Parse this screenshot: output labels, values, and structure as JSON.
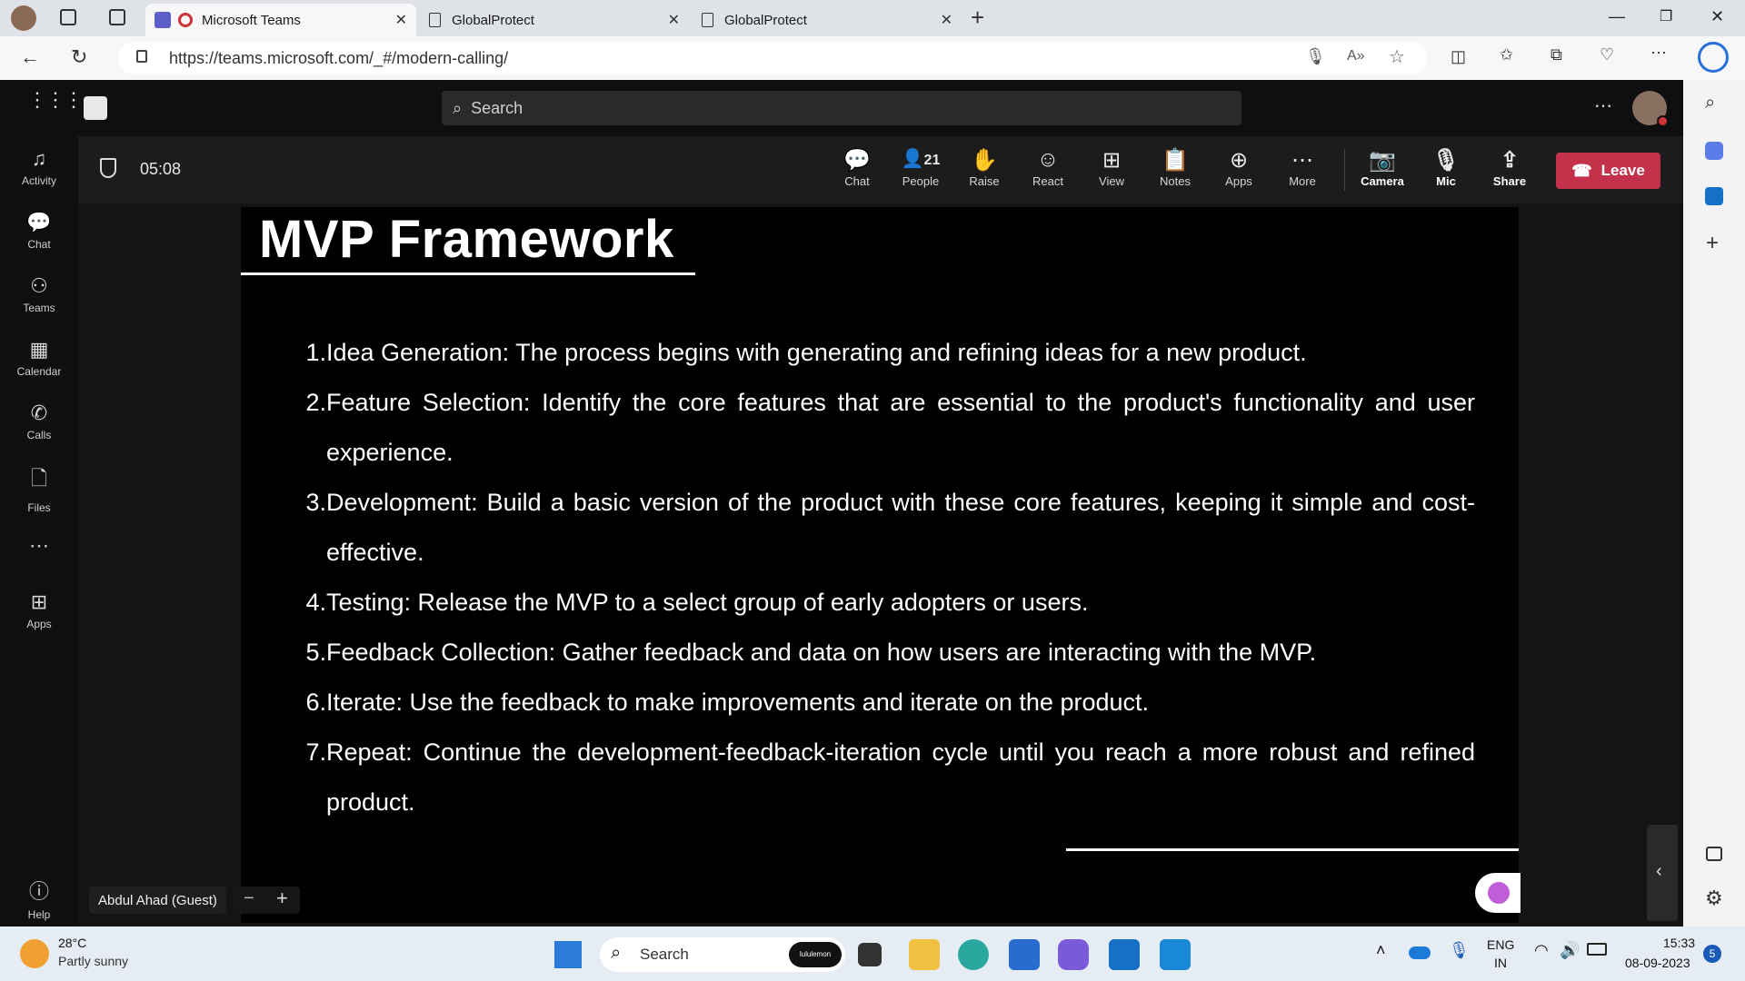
{
  "browser": {
    "tabs": [
      {
        "label": "Microsoft Teams",
        "active": true
      },
      {
        "label": "GlobalProtect",
        "active": false
      },
      {
        "label": "GlobalProtect",
        "active": false
      }
    ],
    "url": "https://teams.microsoft.com/_#/modern-calling/"
  },
  "teams": {
    "search_placeholder": "Search",
    "rail": [
      {
        "label": "Activity",
        "icon": "bell-icon"
      },
      {
        "label": "Chat",
        "icon": "chat-icon"
      },
      {
        "label": "Teams",
        "icon": "teams-icon"
      },
      {
        "label": "Calendar",
        "icon": "calendar-icon"
      },
      {
        "label": "Calls",
        "icon": "phone-icon"
      },
      {
        "label": "Files",
        "icon": "file-icon"
      },
      {
        "label": "Apps",
        "icon": "apps-icon"
      },
      {
        "label": "Help",
        "icon": "help-icon"
      }
    ],
    "meeting": {
      "timer": "05:08",
      "people_count": "21",
      "controls": [
        "Chat",
        "People",
        "Raise",
        "React",
        "View",
        "Notes",
        "Apps",
        "More",
        "Camera",
        "Mic",
        "Share"
      ],
      "leave_label": "Leave",
      "presenter": "Abdul Ahad (Guest)"
    }
  },
  "slide": {
    "title": "MVP Framework",
    "items": [
      {
        "num": "1.",
        "text": "Idea Generation: The process begins with generating and refining ideas for a new product."
      },
      {
        "num": "2.",
        "text": "Feature Selection: Identify the core features that are essential to the product's functionality and user experience."
      },
      {
        "num": "3.",
        "text": "Development: Build a basic version of the product with these core features, keeping it simple and cost-effective."
      },
      {
        "num": "4.",
        "text": "Testing: Release the MVP to a select group of early adopters or users."
      },
      {
        "num": "5.",
        "text": "Feedback Collection: Gather feedback and data on how users are interacting with the MVP."
      },
      {
        "num": "6.",
        "text": "Iterate: Use the feedback to make improvements and iterate on the product."
      },
      {
        "num": "7.",
        "text": "Repeat: Continue the development-feedback-iteration cycle until you reach a more robust and refined product."
      }
    ]
  },
  "taskbar": {
    "weather_temp": "28°C",
    "weather_desc": "Partly sunny",
    "search_label": "Search",
    "app_badge": "lululemon",
    "lang_line1": "ENG",
    "lang_line2": "IN",
    "time": "15:33",
    "date": "08-09-2023",
    "notif_count": "5"
  },
  "colors": {
    "leave": "#c4314b",
    "accent": "#6264a7"
  }
}
